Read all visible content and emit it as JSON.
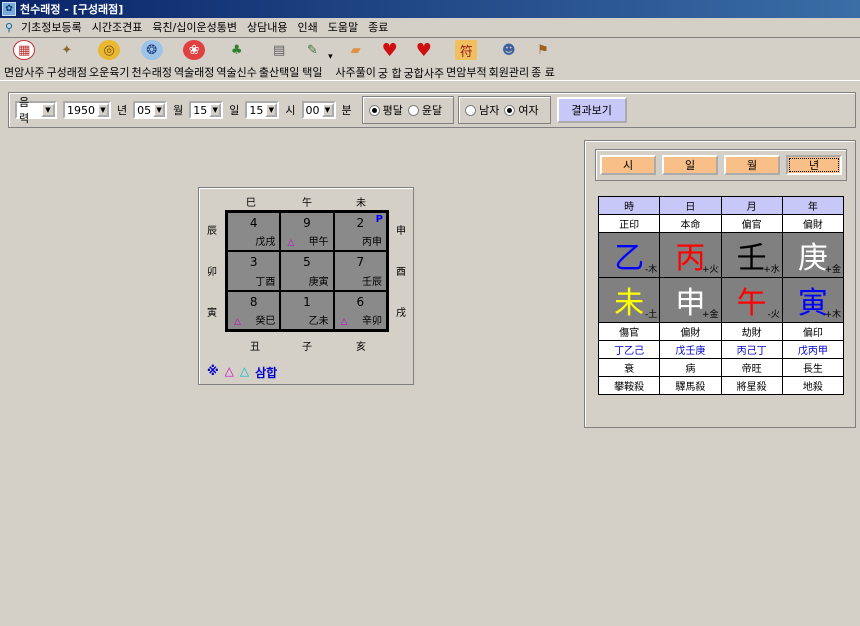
{
  "window": {
    "title": "천수래정 - [구성래점]"
  },
  "menu": [
    "기초정보등록",
    "시간조견표",
    "육친/십이운성통변",
    "상담내용",
    "인쇄",
    "도움말",
    "종료"
  ],
  "toolbar": [
    {
      "label": "면암사주",
      "icon": "calendar-icon",
      "color": "#c03030"
    },
    {
      "label": "구성래점",
      "icon": "fan-icon",
      "color": "#8a6a30"
    },
    {
      "label": "오운육기",
      "icon": "coin-icon",
      "color": "#d0a020"
    },
    {
      "label": "천수래정",
      "icon": "globe-icon",
      "color": "#3070c0"
    },
    {
      "label": "역술래정",
      "icon": "flower-icon",
      "color": "#c02020"
    },
    {
      "label": "역술신수",
      "icon": "tree-icon",
      "color": "#308030"
    },
    {
      "label": "출산택일",
      "icon": "document-icon",
      "color": "#606060"
    },
    {
      "label": "택일",
      "icon": "pen-icon",
      "color": "#407040"
    },
    {
      "label": "사주풀이",
      "icon": "book-icon",
      "color": "#e09040"
    },
    {
      "label": "궁 합",
      "icon": "heart-icon",
      "color": "#d01010"
    },
    {
      "label": "궁합사주",
      "icon": "heart-icon",
      "color": "#d01010"
    },
    {
      "label": "면암부적",
      "icon": "talisman-icon",
      "color": "#e0a040"
    },
    {
      "label": "회원관리",
      "icon": "people-icon",
      "color": "#4060a0"
    },
    {
      "label": "종 료",
      "icon": "sign-icon",
      "color": "#a06020"
    }
  ],
  "input": {
    "calendar": "음력",
    "year": "1950",
    "year_unit": "년",
    "month": "05",
    "month_unit": "월",
    "day": "15",
    "day_unit": "일",
    "hour": "15",
    "hour_unit": "시",
    "minute": "00",
    "minute_unit": "분",
    "leap_normal": "평달",
    "leap": "윤달",
    "male": "남자",
    "female": "여자",
    "result_button": "결과보기"
  },
  "board": {
    "top": [
      "巳",
      "午",
      "未"
    ],
    "left": [
      "辰",
      "卯",
      "寅"
    ],
    "right": [
      "申",
      "酉",
      "戌"
    ],
    "bottom": [
      "丑",
      "子",
      "亥"
    ],
    "cells": [
      {
        "num": "4",
        "sub": "戊戌",
        "tri": ""
      },
      {
        "num": "9",
        "sub": "甲午",
        "tri": "△"
      },
      {
        "num": "2",
        "sub": "丙申",
        "tri": "",
        "mark": "P"
      },
      {
        "num": "3",
        "sub": "丁酉",
        "tri": ""
      },
      {
        "num": "5",
        "sub": "庚寅",
        "tri": ""
      },
      {
        "num": "7",
        "sub": "壬辰",
        "tri": ""
      },
      {
        "num": "8",
        "sub": "癸巳",
        "tri": "△"
      },
      {
        "num": "1",
        "sub": "乙未",
        "tri": ""
      },
      {
        "num": "6",
        "sub": "辛卯",
        "tri": "△"
      }
    ],
    "legend": {
      "mark": "※",
      "t1": "△",
      "t2": "△",
      "text": "삼합"
    }
  },
  "tabs": [
    "시",
    "일",
    "월",
    "년"
  ],
  "saju": {
    "headers": [
      "時",
      "日",
      "月",
      "年"
    ],
    "ten_gods_top": [
      "正印",
      "本命",
      "偏官",
      "偏財"
    ],
    "stems": [
      {
        "char": "乙",
        "color": "#0000ff",
        "el": "-木"
      },
      {
        "char": "丙",
        "color": "#ff0000",
        "el": "+火"
      },
      {
        "char": "壬",
        "color": "#000000",
        "el": "+水"
      },
      {
        "char": "庚",
        "color": "#ffffff",
        "el": "+金"
      }
    ],
    "branches": [
      {
        "char": "未",
        "color": "#ffff00",
        "el": "-土"
      },
      {
        "char": "申",
        "color": "#ffffff",
        "el": "+金"
      },
      {
        "char": "午",
        "color": "#ff0000",
        "el": "-火"
      },
      {
        "char": "寅",
        "color": "#0000ff",
        "el": "+木"
      }
    ],
    "ten_gods_bottom": [
      "傷官",
      "偏財",
      "劫財",
      "偏印"
    ],
    "hidden": [
      "丁乙己",
      "戊壬庚",
      "丙己丁",
      "戊丙甲"
    ],
    "stages": [
      "衰",
      "病",
      "帝旺",
      "長生"
    ],
    "sals": [
      "攀鞍殺",
      "驛馬殺",
      "將星殺",
      "地殺"
    ]
  }
}
